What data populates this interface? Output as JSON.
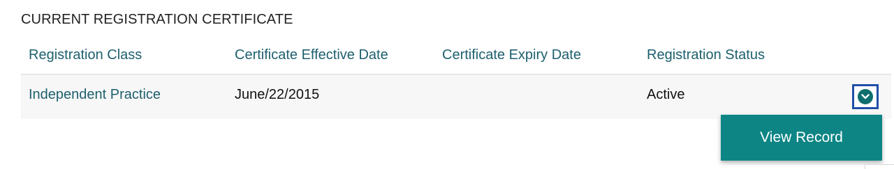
{
  "section": {
    "title": "CURRENT REGISTRATION CERTIFICATE"
  },
  "table": {
    "columns": [
      "Registration Class",
      "Certificate Effective Date",
      "Certificate Expiry Date",
      "Registration Status"
    ],
    "rows": [
      {
        "registration_class": "Independent Practice",
        "effective_date": "June/22/2015",
        "expiry_date": "",
        "status": "Active"
      }
    ]
  },
  "row_actions": {
    "toggle_icon": "chevron-down-circle-icon",
    "menu_items": [
      "View Record"
    ]
  },
  "colors": {
    "link_teal": "#1d5f6e",
    "menu_teal": "#0e8585",
    "focus_blue": "#1f4fa8"
  }
}
